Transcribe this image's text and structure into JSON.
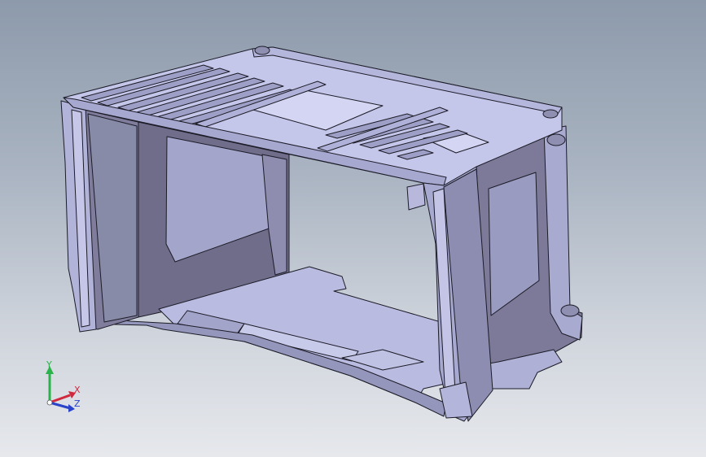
{
  "viewport": {
    "background_top": "#8d9aab",
    "background_bottom": "#e6e8ec"
  },
  "model": {
    "face_light": "#c2c4e6",
    "face_mid": "#a5a6cc",
    "face_dark": "#6a6885",
    "edge_color": "#1c1c28"
  },
  "triad": {
    "y_label": "Y",
    "x_label": "X",
    "z_label": "Z",
    "y_color": "#2bb24a",
    "x_color": "#d0283c",
    "z_color": "#2a43c8"
  }
}
